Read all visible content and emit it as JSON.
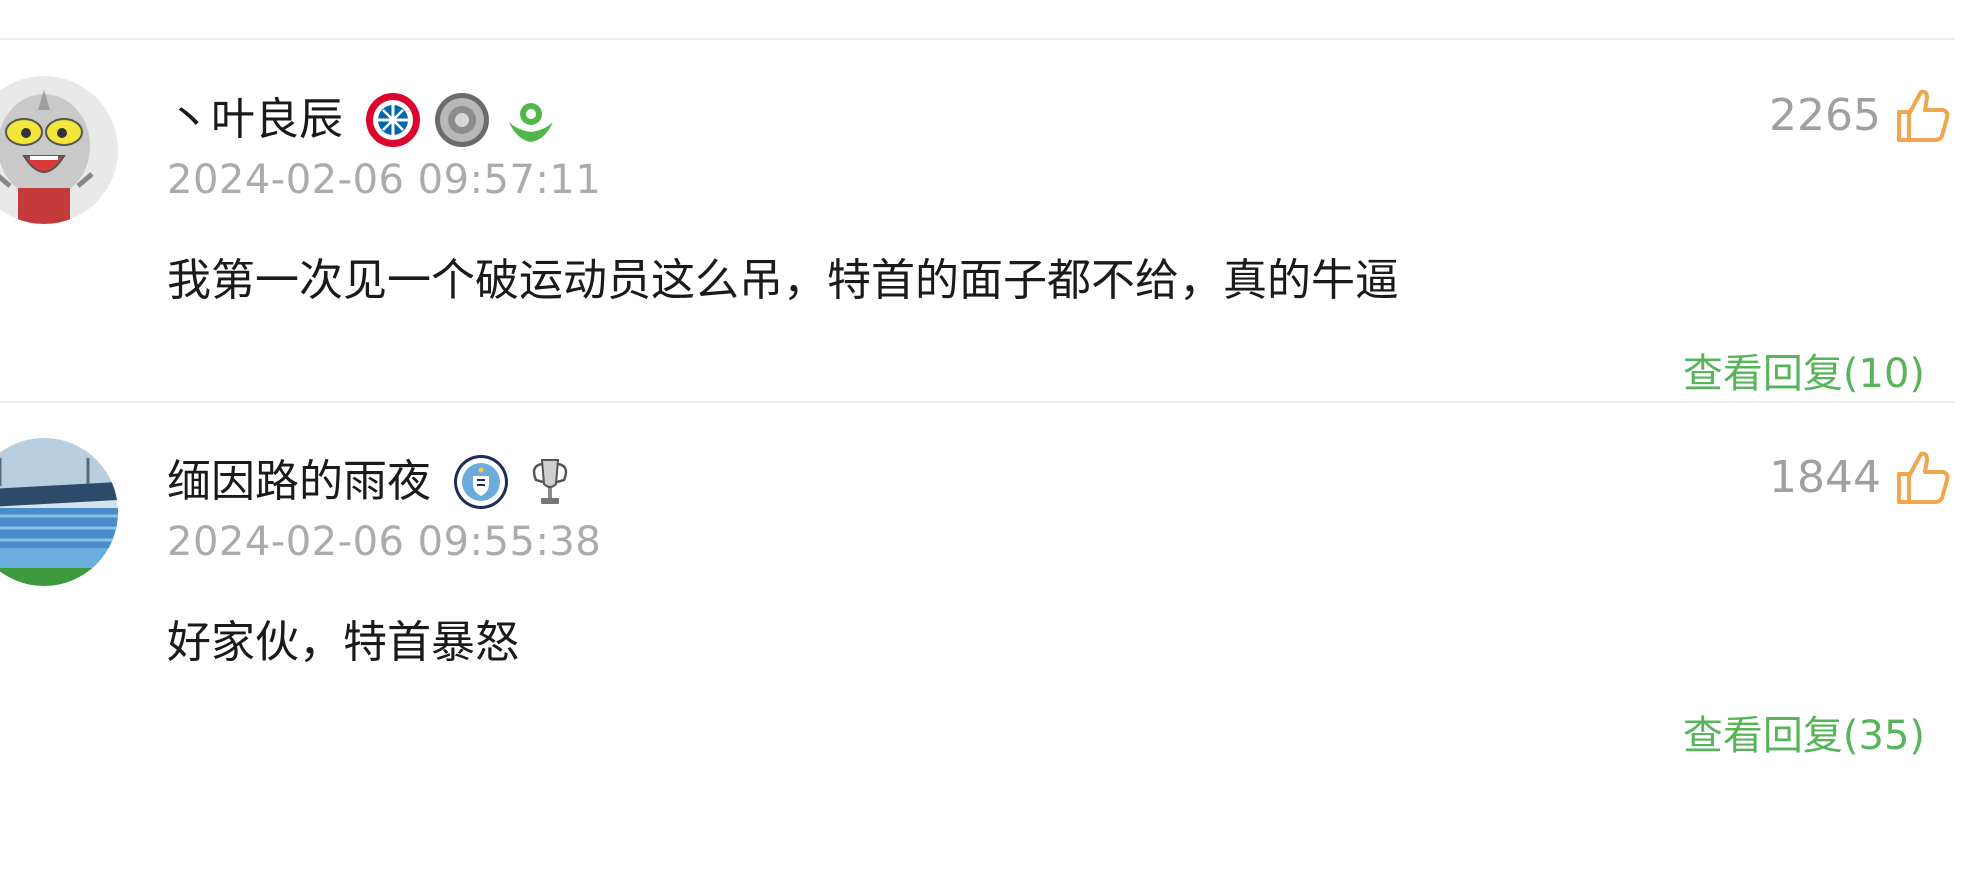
{
  "comments": [
    {
      "username": "丶叶良辰",
      "badges": [
        "bayern-munich-badge-icon",
        "silver-trophy-plate-icon",
        "green-football-hands-icon"
      ],
      "timestamp": "2024-02-06 09:57:11",
      "likes": "2265",
      "content": "我第一次见一个破运动员这么吊，特首的面子都不给，真的牛逼",
      "reply_label": "查看回复(10)",
      "avatar": "ultraman-cartoon-avatar"
    },
    {
      "username": "缅因路的雨夜",
      "badges": [
        "manchester-city-badge-icon",
        "champions-league-trophy-icon"
      ],
      "timestamp": "2024-02-06 09:55:38",
      "likes": "1844",
      "content": "好家伙，特首暴怒",
      "reply_label": "查看回复(35)",
      "avatar": "stadium-photo-avatar"
    }
  ],
  "colors": {
    "reply_link": "#57b45b",
    "like_icon": "#f0a64e",
    "timestamp": "#ababab",
    "divider": "#ededed"
  }
}
